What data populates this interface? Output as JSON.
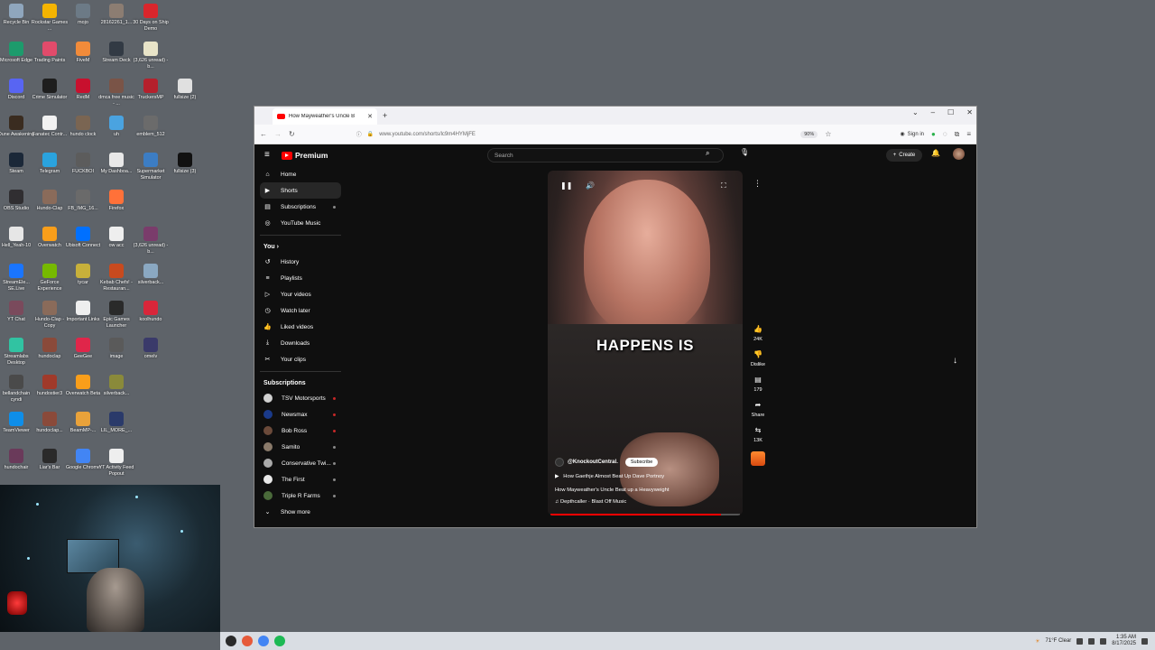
{
  "desktop": {
    "icons": [
      {
        "label": "Recycle Bin",
        "color": "#8fa6bd"
      },
      {
        "label": "Rockstar Games ...",
        "color": "#f5b400"
      },
      {
        "label": "mojo",
        "color": "#6c7a86"
      },
      {
        "label": "28162261_1...",
        "color": "#8c7d72"
      },
      {
        "label": "30 Days on Ship Demo",
        "color": "#d9262c"
      },
      {
        "label": "Microsoft Edge",
        "color": "#1d9b6c"
      },
      {
        "label": "Trading Paints",
        "color": "#e24b6b"
      },
      {
        "label": "FiveM",
        "color": "#f18b3a"
      },
      {
        "label": "Stream Deck",
        "color": "#323a44"
      },
      {
        "label": "(3,626 unread) - b...",
        "color": "#e8e4c8"
      },
      {
        "label": "Discord",
        "color": "#5865f2"
      },
      {
        "label": "Crime Simulator",
        "color": "#1e1e1e"
      },
      {
        "label": "RedM",
        "color": "#c8102e"
      },
      {
        "label": "dmca free music - ...",
        "color": "#7a5447"
      },
      {
        "label": "TruckersMP",
        "color": "#b5202c"
      },
      {
        "label": "fullsize (2)",
        "color": "#e0e0e0"
      },
      {
        "label": "Dune Awakening",
        "color": "#3a2c20"
      },
      {
        "label": "Fanatec Contr...",
        "color": "#f2f2f2"
      },
      {
        "label": "hundo clock",
        "color": "#7a6552"
      },
      {
        "label": "uh",
        "color": "#4aa3e0"
      },
      {
        "label": "emblem_512",
        "color": "#6b6b6b"
      },
      {
        "label": "Steam",
        "color": "#1b2838"
      },
      {
        "label": "Telegram",
        "color": "#2aa3de"
      },
      {
        "label": "FUCKBOI",
        "color": "#5c5c5c"
      },
      {
        "label": "My Dashboa...",
        "color": "#e8e8e8"
      },
      {
        "label": "Supermarket Simulator",
        "color": "#3c7dc4"
      },
      {
        "label": "fullsize (3)",
        "color": "#111111"
      },
      {
        "label": "OBS Studio",
        "color": "#302e31"
      },
      {
        "label": "Hundo-Clap",
        "color": "#8a6b5a"
      },
      {
        "label": "FB_IMG_16...",
        "color": "#6a6a6a"
      },
      {
        "label": "Firefox",
        "color": "#ff7139"
      },
      {
        "label": "Hell_Yeah-10",
        "color": "#e6e6e6"
      },
      {
        "label": "Overwatch",
        "color": "#f99e1a"
      },
      {
        "label": "Ubisoft Connect",
        "color": "#0070ff"
      },
      {
        "label": "ow acc",
        "color": "#eeeeee"
      },
      {
        "label": "(3,626 unread) - b...",
        "color": "#7a3c6b"
      },
      {
        "label": "StreamEle... SE.Live",
        "color": "#1a75ff"
      },
      {
        "label": "GeForce Experience",
        "color": "#76b900"
      },
      {
        "label": "tycar",
        "color": "#c7b03a"
      },
      {
        "label": "Kebab Chefs! - Restauran...",
        "color": "#c84a1e"
      },
      {
        "label": "silverback...",
        "color": "#8aa8c2"
      },
      {
        "label": "YT Chat",
        "color": "#7a4a5c"
      },
      {
        "label": "Hundo-Clap - Copy",
        "color": "#8a6b5a"
      },
      {
        "label": "Important Links",
        "color": "#eeeeee"
      },
      {
        "label": "Epic Games Launcher",
        "color": "#2a2a2a"
      },
      {
        "label": "koolhundo",
        "color": "#d9263a"
      },
      {
        "label": "Streamlabs Desktop",
        "color": "#31c3a2"
      },
      {
        "label": "hundoclap",
        "color": "#8a4a3a"
      },
      {
        "label": "GeeGee",
        "color": "#e0264a"
      },
      {
        "label": "image",
        "color": "#5a5a5a"
      },
      {
        "label": "omelv",
        "color": "#3a3a6a"
      },
      {
        "label": "bellandchain cyndi",
        "color": "#4a4a4a"
      },
      {
        "label": "hundostier3",
        "color": "#a03a2a"
      },
      {
        "label": "Overwatch Beta",
        "color": "#f99e1a"
      },
      {
        "label": "silverback...",
        "color": "#8a8a3a"
      },
      {
        "label": "TeamViewer",
        "color": "#0e8ee9"
      },
      {
        "label": "hundoclap...",
        "color": "#8a4a3a"
      },
      {
        "label": "BeamMP-...",
        "color": "#e9a23a"
      },
      {
        "label": "LIL_MORE_...",
        "color": "#2a3a6a"
      },
      {
        "label": "hundochair",
        "color": "#6a3a5a"
      },
      {
        "label": "Liar's Bar",
        "color": "#2a2a2a"
      },
      {
        "label": "Google Chrome",
        "color": "#4285f4"
      },
      {
        "label": "YT Activity Feed Popout",
        "color": "#eeeeee"
      }
    ]
  },
  "taskbar": {
    "apps": [
      {
        "name": "OBS",
        "color": "#2a2a2a"
      },
      {
        "name": "Firefox",
        "color": "#e65a3a"
      },
      {
        "name": "Chrome",
        "color": "#4285f4"
      },
      {
        "name": "Spotify",
        "color": "#1db954"
      }
    ],
    "weather": "71°F  Clear",
    "time": "1:35 AM",
    "date": "8/17/2025"
  },
  "browser": {
    "tab_title": "How Mayweather's Uncle B",
    "url": "www.youtube.com/shorts/lc9m4HYMjFE",
    "zoom": "90%",
    "signin": "Sign in"
  },
  "youtube": {
    "logo": "Premium",
    "search_placeholder": "Search",
    "create_label": "Create",
    "sidebar": {
      "main": [
        {
          "label": "Home",
          "icon": "⌂"
        },
        {
          "label": "Shorts",
          "icon": "▶"
        },
        {
          "label": "Subscriptions",
          "icon": "▤"
        },
        {
          "label": "YouTube Music",
          "icon": "◎"
        }
      ],
      "you_header": "You",
      "you": [
        {
          "label": "History",
          "icon": "↺"
        },
        {
          "label": "Playlists",
          "icon": "≡"
        },
        {
          "label": "Your videos",
          "icon": "▷"
        },
        {
          "label": "Watch later",
          "icon": "◷"
        },
        {
          "label": "Liked videos",
          "icon": "👍"
        },
        {
          "label": "Downloads",
          "icon": "⤓"
        },
        {
          "label": "Your clips",
          "icon": "✂"
        }
      ],
      "subs_header": "Subscriptions",
      "subs": [
        {
          "label": "TSV Motorsports",
          "color": "#d0d0d0",
          "dot": "#c62828"
        },
        {
          "label": "Newsmax",
          "color": "#1a3a8a",
          "dot": "#c62828"
        },
        {
          "label": "Bob Ross",
          "color": "#6b4a3a",
          "dot": "#c62828"
        },
        {
          "label": "Samito",
          "color": "#8a7a6a",
          "dot": "#888888"
        },
        {
          "label": "Conservative Twi...",
          "color": "#aaaaaa",
          "dot": "#888888"
        },
        {
          "label": "The First",
          "color": "#e8e8e8",
          "dot": "#888888"
        },
        {
          "label": "Triple R Farms",
          "color": "#4a6a3a",
          "dot": "#888888"
        }
      ],
      "show_more": "Show more"
    },
    "short": {
      "caption": "HAPPENS IS",
      "channel": "@KnockoutCentral.",
      "subscribe": "Subscribe",
      "related": "How Gaethje Almost Beat Up Dave Portnoy",
      "title": "How Mayweather's Uncle Beat up a Heavyweight",
      "music": "Depthcaller · Blast Off Music",
      "progress": 0.9
    },
    "actions": {
      "likes": "24K",
      "dislike": "Dislike",
      "comments": "179",
      "share": "Share",
      "remix": "13K"
    }
  }
}
